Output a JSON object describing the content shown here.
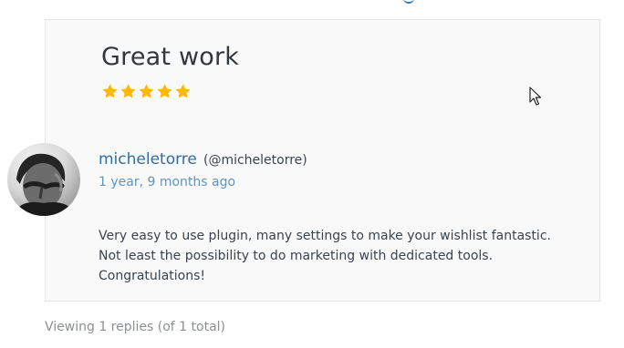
{
  "review": {
    "title": "Great work",
    "rating": 5,
    "author": "micheletorre",
    "handle": "(@micheletorre)",
    "time": "1 year, 9 months ago",
    "body": "Very easy to use plugin, many settings to make your wishlist fantastic. Not least the possibility to do marketing with dedicated tools. Congratulations!"
  },
  "footer": {
    "reply_count_text": "Viewing 1 replies (of 1 total)"
  },
  "colors": {
    "star": "#ffb900",
    "link": "#2f6f9f",
    "meta_link": "#5f95c2",
    "card_background": "#f9f9f9"
  },
  "icons": {
    "rating": "star-icon",
    "pointer": "cursor-icon"
  }
}
